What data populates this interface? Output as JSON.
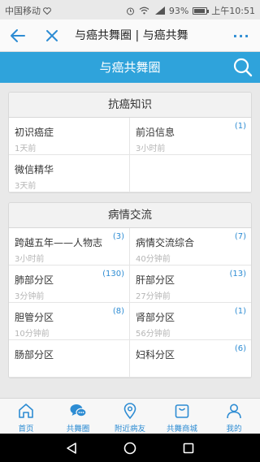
{
  "status_bar": {
    "carrier": "中国移动",
    "battery": "93%",
    "battery_level": 0.93,
    "time": "上午10:51"
  },
  "navbar": {
    "title": "与癌共舞圈 | 与癌共舞",
    "more_label": "···"
  },
  "header": {
    "title": "与癌共舞圈"
  },
  "sections": [
    {
      "title": "抗癌知识",
      "items": [
        {
          "title": "初识癌症",
          "time": "1天前",
          "badge": ""
        },
        {
          "title": "前沿信息",
          "time": "3小时前",
          "badge": "(1)"
        },
        {
          "title": "微信精华",
          "time": "3天前",
          "badge": ""
        }
      ]
    },
    {
      "title": "病情交流",
      "items": [
        {
          "title": "跨越五年——人物志",
          "time": "3小时前",
          "badge": "(3)"
        },
        {
          "title": "病情交流综合",
          "time": "40分钟前",
          "badge": "(7)"
        },
        {
          "title": "肺部分区",
          "time": "3分钟前",
          "badge": "(130)"
        },
        {
          "title": "肝部分区",
          "time": "27分钟前",
          "badge": "(13)"
        },
        {
          "title": "胆管分区",
          "time": "10分钟前",
          "badge": "(8)"
        },
        {
          "title": "肾部分区",
          "time": "56分钟前",
          "badge": "(1)"
        },
        {
          "title": "肠部分区",
          "time": "",
          "badge": ""
        },
        {
          "title": "妇科分区",
          "time": "",
          "badge": "(6)"
        }
      ]
    }
  ],
  "tabs": [
    {
      "label": "首页",
      "icon": "home-icon"
    },
    {
      "label": "共舞圈",
      "icon": "chat-bubbles-icon"
    },
    {
      "label": "附近病友",
      "icon": "location-pin-icon"
    },
    {
      "label": "共舞商城",
      "icon": "shopping-bag-icon"
    },
    {
      "label": "我的",
      "icon": "user-icon"
    }
  ],
  "colors": {
    "accent": "#2fa3db",
    "link": "#2d8cd3"
  }
}
